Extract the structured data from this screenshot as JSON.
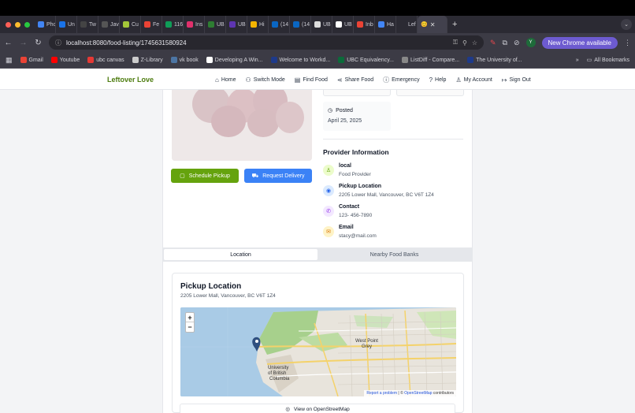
{
  "browser": {
    "tabs": [
      {
        "label": "Pho",
        "color": "#4285f4"
      },
      {
        "label": "Un",
        "color": "#1a73e8"
      },
      {
        "label": "Tw",
        "color": "#444444"
      },
      {
        "label": "Jav",
        "color": "#555555"
      },
      {
        "label": "Cu",
        "color": "#a4c639"
      },
      {
        "label": "Fe",
        "color": "#ea4335"
      },
      {
        "label": "116",
        "color": "#0f9d58"
      },
      {
        "label": "Ins",
        "color": "#e1306c"
      },
      {
        "label": "UB",
        "color": "#2e7d32"
      },
      {
        "label": "UB",
        "color": "#5e35b1"
      },
      {
        "label": "Hi",
        "color": "#f4b400"
      },
      {
        "label": "(14",
        "color": "#0a66c2"
      },
      {
        "label": "(14",
        "color": "#0a66c2"
      },
      {
        "label": "UB",
        "color": "#dddddd"
      },
      {
        "label": "UB",
        "color": "#ffffff"
      },
      {
        "label": "Inb",
        "color": "#ea4335"
      },
      {
        "label": "Ha",
        "color": "#4285f4"
      },
      {
        "label": "Lef",
        "color": "#2b2a33"
      }
    ],
    "active_tab_icon": "😊",
    "url": "localhost:8080/food-listing/1745631580924",
    "new_chrome_label": "New Chrome available",
    "avatar_letter": "Y",
    "bookmarks": [
      {
        "label": "Gmail",
        "color": "#ea4335"
      },
      {
        "label": "Youtube",
        "color": "#ff0000"
      },
      {
        "label": "ubc canvas",
        "color": "#e53935"
      },
      {
        "label": "Z-Library",
        "color": "#cccccc"
      },
      {
        "label": "vk book",
        "color": "#4c75a3"
      },
      {
        "label": "Developing A Win...",
        "color": "#ffffff"
      },
      {
        "label": "Welcome to Workd...",
        "color": "#1e3a8a"
      },
      {
        "label": "UBC Equivalency...",
        "color": "#0b6b3a"
      },
      {
        "label": "ListDiff - Compare...",
        "color": "#888888"
      },
      {
        "label": "The University of...",
        "color": "#1e3a8a"
      }
    ],
    "all_bookmarks_label": "All Bookmarks",
    "bookmarks_more": "»"
  },
  "app": {
    "logo": "Leftover Love",
    "nav": [
      {
        "label": "Home",
        "icon": "⌂"
      },
      {
        "label": "Switch Mode",
        "icon": "⚇"
      },
      {
        "label": "Find Food",
        "icon": "▤"
      },
      {
        "label": "Share Food",
        "icon": "⋖"
      },
      {
        "label": "Emergency",
        "icon": "ⓘ"
      },
      {
        "label": "Help",
        "icon": "?"
      },
      {
        "label": "My Account",
        "icon": "♙"
      },
      {
        "label": "Sign Out",
        "icon": "↦"
      }
    ]
  },
  "listing": {
    "schedule_label": "Schedule Pickup",
    "delivery_label": "Request Delivery",
    "posted_label": "Posted",
    "posted_date": "April 25, 2025",
    "provider_title": "Provider Information",
    "provider": {
      "name": "local",
      "role": "Food Provider",
      "pickup_label": "Pickup Location",
      "pickup_address": "2205 Lower Mall, Vancouver, BC V6T 1Z4",
      "contact_label": "Contact",
      "contact_phone": "123- 456-7890",
      "email_label": "Email",
      "email": "stacy@mail.com"
    }
  },
  "tabs": {
    "location": "Location",
    "food_banks": "Nearby Food Banks"
  },
  "map_card": {
    "title": "Pickup Location",
    "address": "2205 Lower Mall, Vancouver, BC V6T 1Z4",
    "zoom_in": "+",
    "zoom_out": "−",
    "labels": {
      "west_point_grey": "West Point",
      "grey": "Grey",
      "university": "University",
      "of_british": "of British",
      "columbia": "Columbia"
    },
    "attribution_report": "Report a problem",
    "attribution_sep": " | © ",
    "attribution_osm": "OpenStreetMap",
    "attribution_tail": " contributors",
    "osm_button": "View on OpenStreetMap"
  }
}
